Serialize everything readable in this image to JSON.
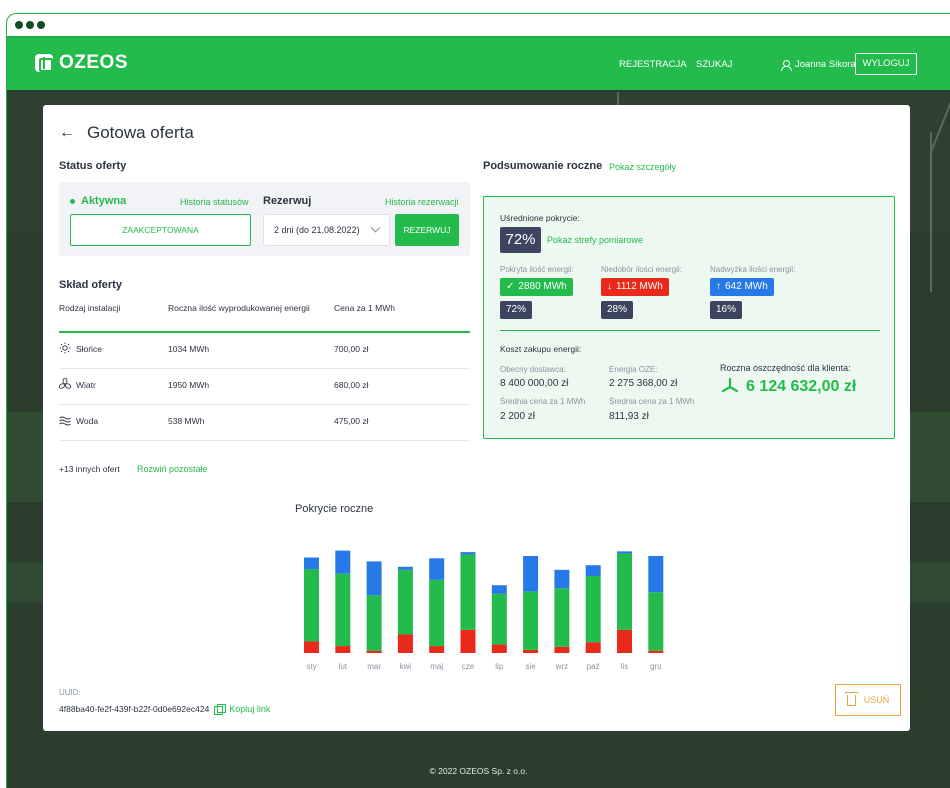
{
  "app": {
    "logo_text": "OZEOS",
    "nav": {
      "register": "REJESTRACJA",
      "search": "SZUKAJ"
    },
    "user_name": "Joanna Sikora",
    "logout_label": "WYLOGUJ"
  },
  "page": {
    "title": "Gotowa oferta",
    "back_icon": "arrow-left-icon",
    "footer": "© 2022 OZEOS Sp. z o.o."
  },
  "status": {
    "heading": "Status oferty",
    "state": "Aktywna",
    "history_link": "Historia statusów",
    "accepted_label": "ZAAKCEPTOWANA",
    "reserve_heading": "Rezerwuj",
    "reserve_history_link": "Historia rezerwacji",
    "reserve_select_value": "2 dni (do 21.08.2022)",
    "reserve_button": "REZERWUJ"
  },
  "composition": {
    "heading": "Skład oferty",
    "columns": [
      "Rodzaj instalacji",
      "Roczna ilość wyprodukowanej energii",
      "Cena za 1 MWh"
    ],
    "rows": [
      {
        "type": "Słońce",
        "icon": "sun-icon",
        "energy": "1034 MWh",
        "price": "700,00 zł"
      },
      {
        "type": "Wiatr",
        "icon": "wind-turbine-icon",
        "energy": "1950 MWh",
        "price": "680,00 zł"
      },
      {
        "type": "Woda",
        "icon": "water-icon",
        "energy": "538 MWh",
        "price": "475,00 zł"
      }
    ],
    "more_offers": "+13 innych ofert",
    "expand_link": "Rozwiń pozostałe"
  },
  "summary": {
    "heading": "Podsumowanie roczne",
    "details_link": "Pokaż szczegóły",
    "avg_coverage_label": "Uśrednione pokrycie:",
    "avg_coverage_value": "72%",
    "zones_link": "Pokaż strefy pomiarowe",
    "covered_label": "Pokryta ilość energii:",
    "covered_value": "2880 MWh",
    "covered_pct": "72%",
    "shortage_label": "Niedobór ilości energii:",
    "shortage_value": "1112 MWh",
    "shortage_pct": "28%",
    "surplus_label": "Nadwyżka ilości energii:",
    "surplus_value": "642 MWh",
    "surplus_pct": "16%",
    "cost_heading": "Koszt zakupu energii:",
    "supplier_label": "Obecny dostawca:",
    "supplier_value": "8 400 000,00 zł",
    "supplier_avg_label": "Średnia cena za 1 MWh",
    "supplier_avg_value": "2 200 zł",
    "oze_label": "Energia OZE:",
    "oze_value": "2 275 368,00 zł",
    "oze_avg_label": "Średnia cena za 1 MWh",
    "oze_avg_value": "811,93 zł",
    "savings_label": "Roczna oszczędność dla klienta:",
    "savings_value": "6 124 632,00 zł"
  },
  "chart": {
    "title": "Pokrycie roczne"
  },
  "chart_data": {
    "type": "bar",
    "stacked": true,
    "categories": [
      "sty",
      "lut",
      "mar",
      "kwi",
      "maj",
      "cze",
      "lip",
      "sie",
      "wrz",
      "paź",
      "lis",
      "gru"
    ],
    "series": [
      {
        "color": "#e92a1a",
        "values": [
          15,
          9,
          3,
          24,
          9,
          30,
          11,
          4,
          8,
          14,
          30,
          3
        ]
      },
      {
        "color": "#23bb4b",
        "values": [
          94,
          94,
          72,
          84,
          86,
          98,
          66,
          76,
          76,
          86,
          99,
          76
        ]
      },
      {
        "color": "#2879e8",
        "values": [
          15,
          30,
          44,
          4,
          28,
          3,
          11,
          46,
          24,
          14,
          3,
          47
        ]
      }
    ],
    "colors": {
      "shortage": "#e92a1a",
      "covered": "#23bb4b",
      "surplus": "#2879e8"
    }
  },
  "uuid": {
    "label": "UUID:",
    "value": "4f88ba40-fe2f-439f-b22f-0d0e692ec424",
    "copy_link": "Kopiuj link"
  },
  "delete_label": "USUŃ"
}
